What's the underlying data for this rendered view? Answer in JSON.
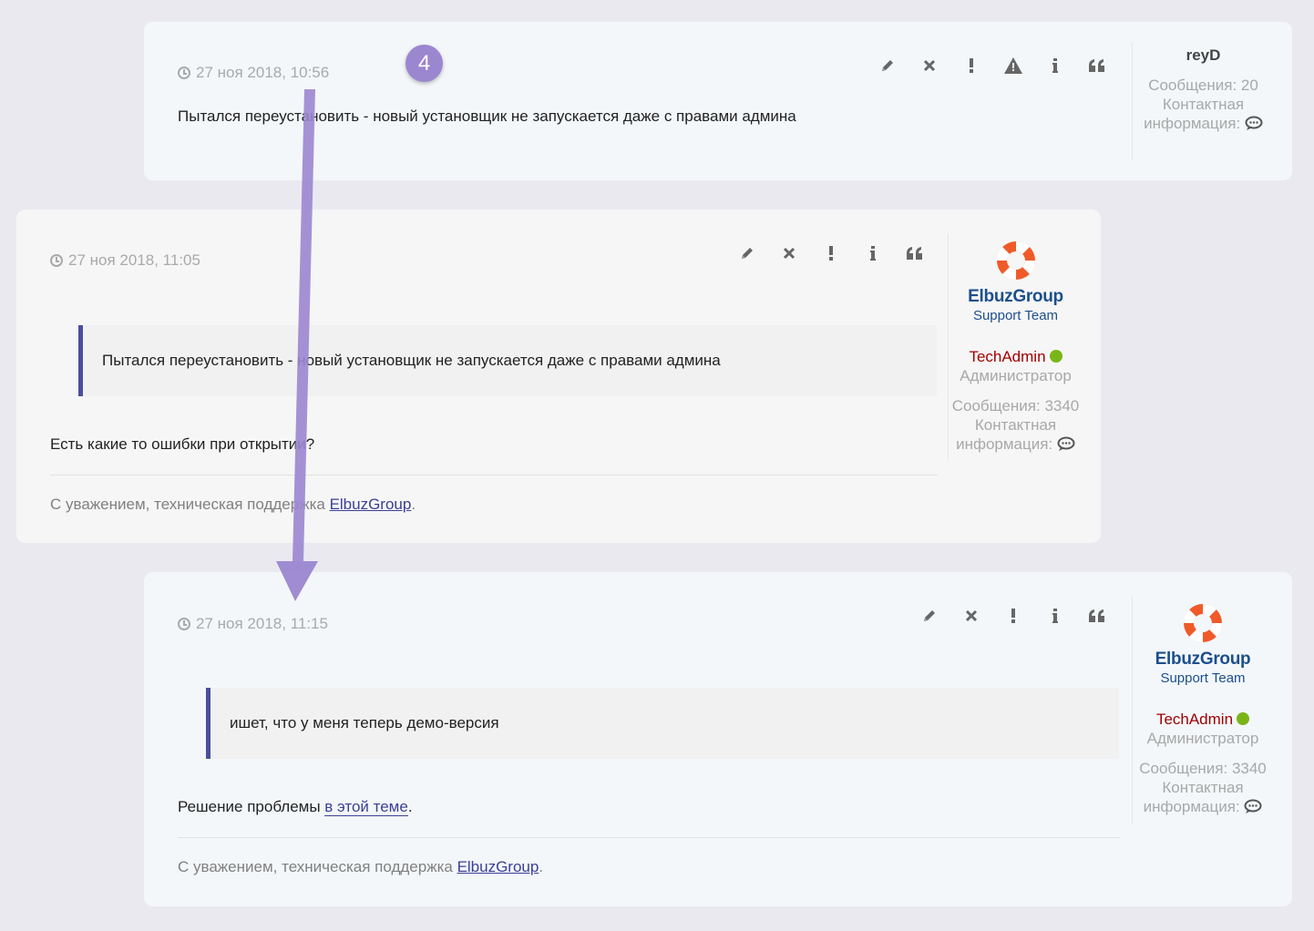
{
  "colors": {
    "accent": "#4a4f9c",
    "admin_name": "#a00000",
    "online": "#7ab518",
    "annotation": "#9b86d0",
    "muted": "#a9a9a9"
  },
  "annotation": {
    "step_number": "4"
  },
  "posts": [
    {
      "date": "27 ноя 2018, 10:56",
      "actions": [
        "pencil-icon",
        "close-icon",
        "exclamation-icon",
        "warning-icon",
        "info-icon",
        "quote-icon"
      ],
      "text": "Пытался переустановить - новый установщик не запускается даже с правами админа",
      "author": {
        "name": "reyD",
        "posts_label": "Сообщения: 20",
        "contact_line1": "Контактная",
        "contact_line2": "информация:"
      }
    },
    {
      "date": "27 ноя 2018, 11:05",
      "actions": [
        "pencil-icon",
        "close-icon",
        "exclamation-icon",
        "info-icon",
        "quote-icon"
      ],
      "quote": "Пытался переустановить - новый установщик не запускается даже с правами админа",
      "text": "Есть какие то ошибки при открытии?",
      "signature_prefix": "С уважением, техническая поддержка ",
      "signature_link": "ElbuzGroup",
      "signature_suffix": ".",
      "author": {
        "logo_title": "ElbuzGroup",
        "logo_sub": "Support Team",
        "name": "TechAdmin",
        "role": "Администратор",
        "posts_label": "Сообщения: 3340",
        "contact_line1": "Контактная",
        "contact_line2": "информация:"
      }
    },
    {
      "date": "27 ноя 2018, 11:15",
      "actions": [
        "pencil-icon",
        "close-icon",
        "exclamation-icon",
        "info-icon",
        "quote-icon"
      ],
      "quote": "ишет, что у меня теперь демо-версия",
      "text_prefix": "Решение проблемы ",
      "text_link": "в этой теме",
      "text_suffix": ".",
      "signature_prefix": "С уважением, техническая поддержка ",
      "signature_link": "ElbuzGroup",
      "signature_suffix": ".",
      "author": {
        "logo_title": "ElbuzGroup",
        "logo_sub": "Support Team",
        "name": "TechAdmin",
        "role": "Администратор",
        "posts_label": "Сообщения: 3340",
        "contact_line1": "Контактная",
        "contact_line2": "информация:"
      }
    }
  ]
}
